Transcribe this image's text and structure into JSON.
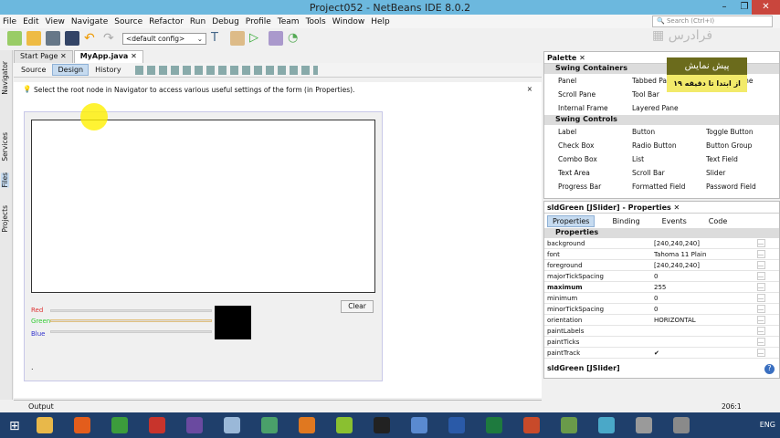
{
  "window": {
    "title": "Project052 - NetBeans IDE 8.0.2"
  },
  "menu": [
    "File",
    "Edit",
    "View",
    "Navigate",
    "Source",
    "Refactor",
    "Run",
    "Debug",
    "Profile",
    "Team",
    "Tools",
    "Window",
    "Help"
  ],
  "toolbar": {
    "config": "<default config>"
  },
  "search": {
    "placeholder": "Search (Ctrl+I)"
  },
  "logo": "فرادرس",
  "left_strip": [
    "Navigator",
    "Services",
    "Files",
    "Projects"
  ],
  "tabs": [
    "Start Page",
    "MyApp.java"
  ],
  "editor_tabs": [
    "Source",
    "Design",
    "History"
  ],
  "hint": "Select the root node in Navigator to access various useful settings of the form (in Properties).",
  "form": {
    "labels": [
      "Red",
      "Green",
      "Blue"
    ],
    "clear": "Clear",
    "dot": "."
  },
  "output": "Output",
  "status": "206:1",
  "palette": {
    "title": "Palette",
    "groups": [
      {
        "name": "Swing Containers",
        "items": [
          "Panel",
          "Tabbed Pane",
          "Desktop Pane",
          "Scroll Pane",
          "Tool Bar",
          "",
          "Internal Frame",
          "Layered Pane",
          ""
        ]
      },
      {
        "name": "Swing Controls",
        "items": [
          "Label",
          "Button",
          "Toggle Button",
          "Check Box",
          "Radio Button",
          "Button Group",
          "Combo Box",
          "List",
          "Text Field",
          "Text Area",
          "Scroll Bar",
          "Slider",
          "Progress Bar",
          "Formatted Field",
          "Password Field"
        ]
      }
    ]
  },
  "promo": {
    "title": "پیش نمایش",
    "subtitle": "از ابتدا تا دقیقه ۱۹"
  },
  "properties": {
    "title": "sldGreen [JSlider] - Properties",
    "tabs": [
      "Properties",
      "Binding",
      "Events",
      "Code"
    ],
    "section": "Properties",
    "rows": [
      {
        "k": "background",
        "v": "[240,240,240]"
      },
      {
        "k": "font",
        "v": "Tahoma 11 Plain"
      },
      {
        "k": "foreground",
        "v": "[240,240,240]"
      },
      {
        "k": "majorTickSpacing",
        "v": "0"
      },
      {
        "k": "maximum",
        "v": "255"
      },
      {
        "k": "minimum",
        "v": "0"
      },
      {
        "k": "minorTickSpacing",
        "v": "0"
      },
      {
        "k": "orientation",
        "v": "HORIZONTAL"
      },
      {
        "k": "paintLabels",
        "v": ""
      },
      {
        "k": "paintTicks",
        "v": ""
      },
      {
        "k": "paintTrack",
        "v": "✔"
      }
    ],
    "footer": "sldGreen [JSlider]"
  },
  "taskbar": {
    "lang": "ENG"
  }
}
